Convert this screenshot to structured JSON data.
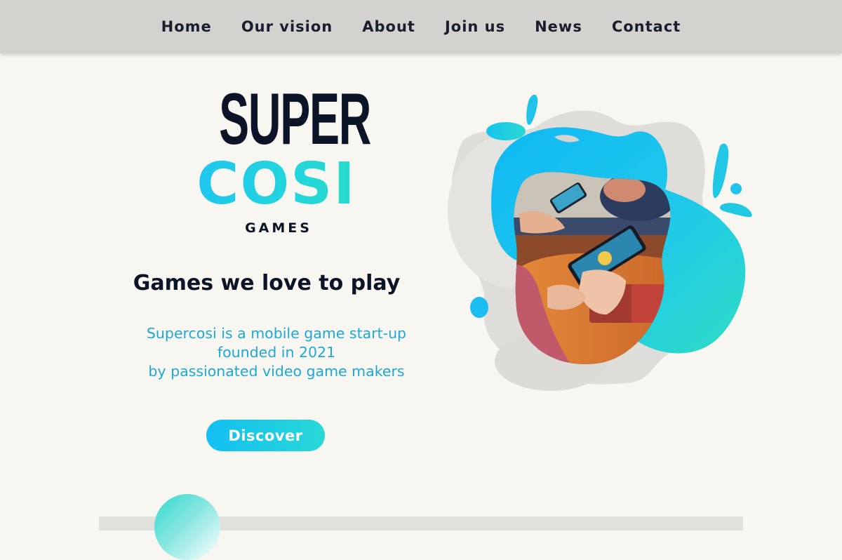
{
  "nav": {
    "items": [
      {
        "label": "Home"
      },
      {
        "label": "Our vision"
      },
      {
        "label": "About"
      },
      {
        "label": "Join us"
      },
      {
        "label": "News"
      },
      {
        "label": "Contact"
      }
    ]
  },
  "logo": {
    "line1": "SUPER",
    "line2": "COSI",
    "line3": "GAMES"
  },
  "hero": {
    "tagline": "Games we love to play",
    "description": [
      "Supercosi is a mobile game start-up",
      "founded in 2021",
      "by passionated video game makers"
    ],
    "cta_label": "Discover"
  },
  "colors": {
    "nav_bg": "#d3d2cf",
    "page_bg": "#f8f6f0",
    "brand_dark": "#0c1427",
    "accent_blue": "#12bff2",
    "accent_teal": "#2bdcc8",
    "description_text": "#1ea8d6"
  }
}
